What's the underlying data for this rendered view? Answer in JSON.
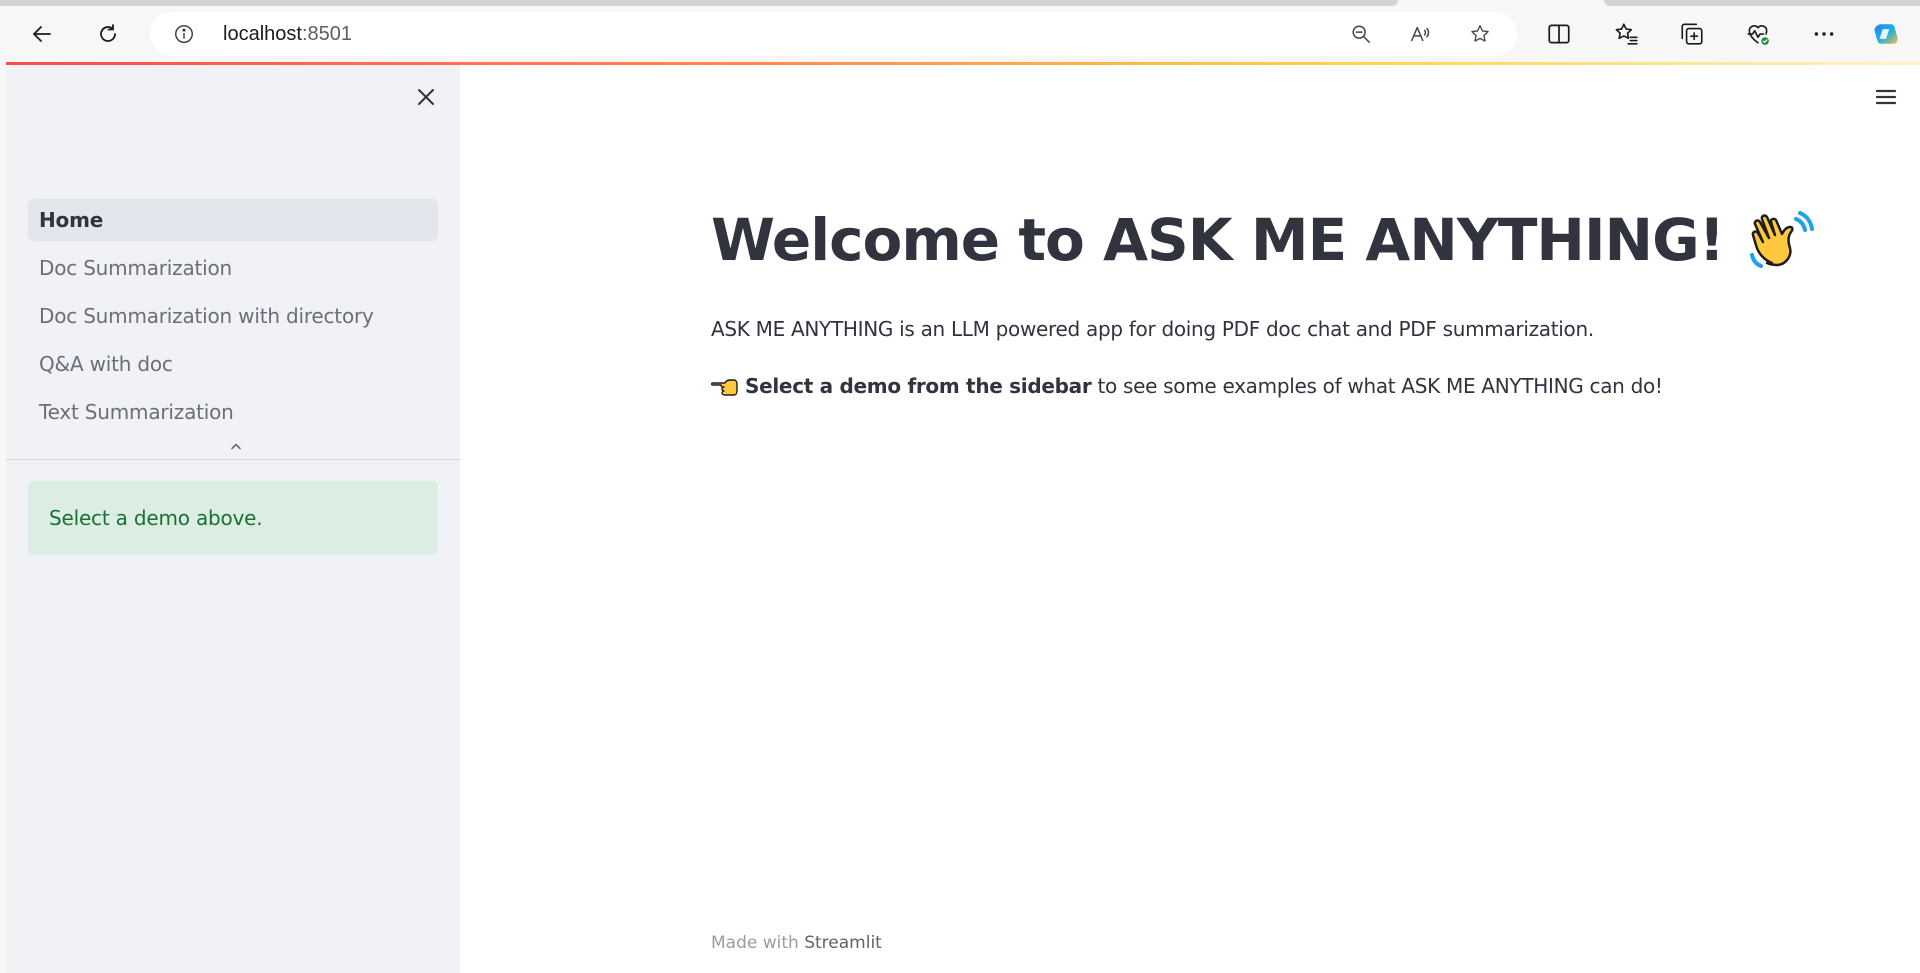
{
  "browser": {
    "url_host": "localhost",
    "url_port": ":8501",
    "icons": {
      "back": "back-arrow-icon",
      "refresh": "refresh-icon",
      "site_info": "info-icon",
      "zoom_out": "zoom-out-icon",
      "read_aloud": "read-aloud-icon",
      "favorite": "star-icon",
      "split_screen": "split-screen-icon",
      "favorites": "favorites-icon",
      "collections": "collections-icon",
      "health": "heart-health-icon",
      "more": "more-icon",
      "copilot": "copilot-icon"
    },
    "accent_gradient": [
      "#ff4b4b",
      "#ffd24b"
    ]
  },
  "sidebar": {
    "nav_items": [
      {
        "label": "Home",
        "active": true
      },
      {
        "label": "Doc Summarization",
        "active": false
      },
      {
        "label": "Doc Summarization with directory",
        "active": false
      },
      {
        "label": "Q&A with doc",
        "active": false
      },
      {
        "label": "Text Summarization",
        "active": false
      }
    ],
    "info_message": "Select a demo above.",
    "info_color": "#177233"
  },
  "main": {
    "title": "Welcome to ASK ME ANYTHING!",
    "title_emoji": "waving-hand",
    "intro": "ASK ME ANYTHING is an LLM powered app for doing PDF doc chat and PDF summarization.",
    "cta_emoji": "pointing-hand-left",
    "cta_bold": "Select a demo from the sidebar",
    "cta_rest": " to see some examples of what ASK ME ANYTHING can do!",
    "footer_prefix": "Made with ",
    "footer_brand": "Streamlit"
  }
}
